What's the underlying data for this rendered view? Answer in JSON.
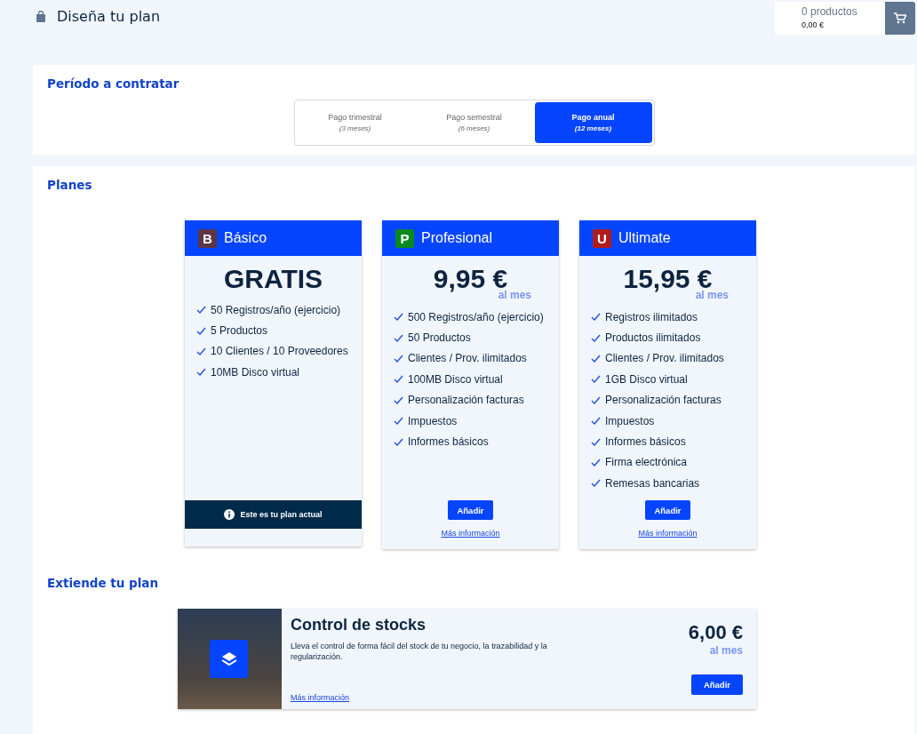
{
  "header": {
    "title": "Diseña tu plan",
    "cart": {
      "count": "0 productos",
      "total": "0,00 €"
    }
  },
  "period": {
    "title": "Período a contratar",
    "options": [
      {
        "label": "Pago trimestral",
        "detail": "(3 meses)",
        "selected": false
      },
      {
        "label": "Pago semestral",
        "detail": "(6 meses)",
        "selected": false
      },
      {
        "label": "Pago anual",
        "detail": "(12 meses)",
        "selected": true
      }
    ]
  },
  "plans": {
    "title": "Planes",
    "items": [
      {
        "kind": "current",
        "letter": "B",
        "color": "#5c3645",
        "name": "Básico",
        "price": "GRATIS",
        "features": [
          "50 Registros/año (ejercicio)",
          "5 Productos",
          "10 Clientes / 10 Proveedores",
          "10MB Disco virtual"
        ],
        "note": "Este es tu plan actual"
      },
      {
        "kind": "offer",
        "letter": "P",
        "color": "#0a8a1e",
        "name": "Profesional",
        "price": "9,95 €",
        "per": "al mes",
        "features": [
          "500 Registros/año (ejercicio)",
          "50 Productos",
          "Clientes / Prov. ilimitados",
          "100MB Disco virtual",
          "Personalización facturas",
          "Impuestos",
          "Informes básicos"
        ],
        "button": "Añadir",
        "link": "Más información"
      },
      {
        "kind": "offer",
        "letter": "U",
        "color": "#b01c1c",
        "name": "Ultimate",
        "price": "15,95 €",
        "per": "al mes",
        "features": [
          "Registros ilimitados",
          "Productos ilimitados",
          "Clientes / Prov. ilimitados",
          "1GB Disco virtual",
          "Personalización facturas",
          "Impuestos",
          "Informes básicos",
          "Firma electrónica",
          "Remesas bancarias"
        ],
        "button": "Añadir",
        "link": "Más información"
      }
    ]
  },
  "extensions": {
    "title": "Extiende tu plan",
    "items": [
      {
        "name": "Control de stocks",
        "description": "Lleva el control de forma fácil del stock de tu negocio, la trazabilidad y la regularización.",
        "link": "Más información",
        "price": "6,00 €",
        "per": "al mes",
        "button": "Añadir"
      }
    ]
  }
}
